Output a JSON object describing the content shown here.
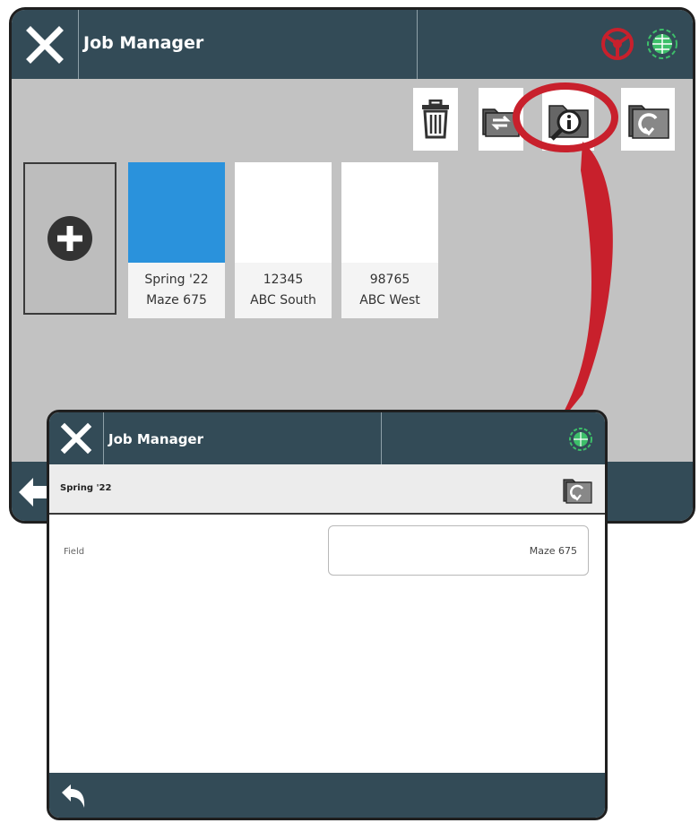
{
  "back_screen": {
    "title": "Job Manager",
    "jobs": [
      {
        "line1": "Spring '22",
        "line2": "Maze 675",
        "selected": true
      },
      {
        "line1": "12345",
        "line2": "ABC South",
        "selected": false
      },
      {
        "line1": "98765",
        "line2": "ABC West",
        "selected": false
      }
    ],
    "toolbar": [
      "delete-icon",
      "transfer-job-icon",
      "job-info-icon",
      "resume-job-icon"
    ]
  },
  "front_screen": {
    "title": "Job Manager",
    "job_name": "Spring '22",
    "field_label": "Field",
    "field_value": "Maze 675"
  },
  "colors": {
    "header": "#334b57",
    "selected_tile": "#2a92dc",
    "highlight": "#c8202c",
    "gnss_status": "#3dbf6a",
    "steering_alert": "#c8202c"
  }
}
